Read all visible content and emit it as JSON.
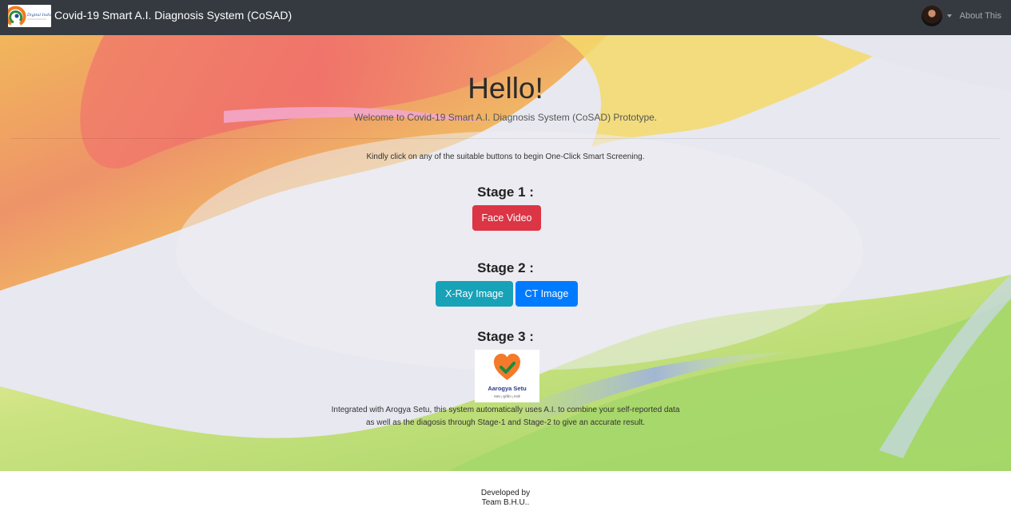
{
  "navbar": {
    "logo_text": "Digital India",
    "title": "Covid-19 Smart A.I. Diagnosis System (CoSAD)",
    "about": "About This"
  },
  "hero": {
    "heading": "Hello!",
    "welcome": "Welcome to Covid-19 Smart A.I. Diagnosis System (CoSAD) Prototype.",
    "instruction": "Kindly click on any of the suitable buttons to begin One-Click Smart Screening."
  },
  "stage1": {
    "label": "Stage 1 :",
    "face_video": "Face Video"
  },
  "stage2": {
    "label": "Stage 2 :",
    "xray": "X-Ray Image",
    "ct": "CT Image"
  },
  "stage3": {
    "label": "Stage 3 :",
    "app_name": "Aarogya Setu",
    "app_tagline": "स्वस्थ | सुरक्षित | सतर्क",
    "description_line1": "Integrated with Arogya Setu, this system automatically uses A.I. to combine your self-reported data",
    "description_line2": "as well as the diagosis through Stage-1 and Stage-2 to give an accurate result."
  },
  "footer": {
    "line1": "Developed by",
    "line2": "Team B.H.U.."
  },
  "colors": {
    "navbar": "#343a40",
    "danger": "#dc3545",
    "info": "#17a2b8",
    "primary": "#007bff"
  },
  "icons": {
    "avatar": "user-avatar",
    "caret": "caret-down-icon",
    "heart": "heart-check-icon"
  }
}
